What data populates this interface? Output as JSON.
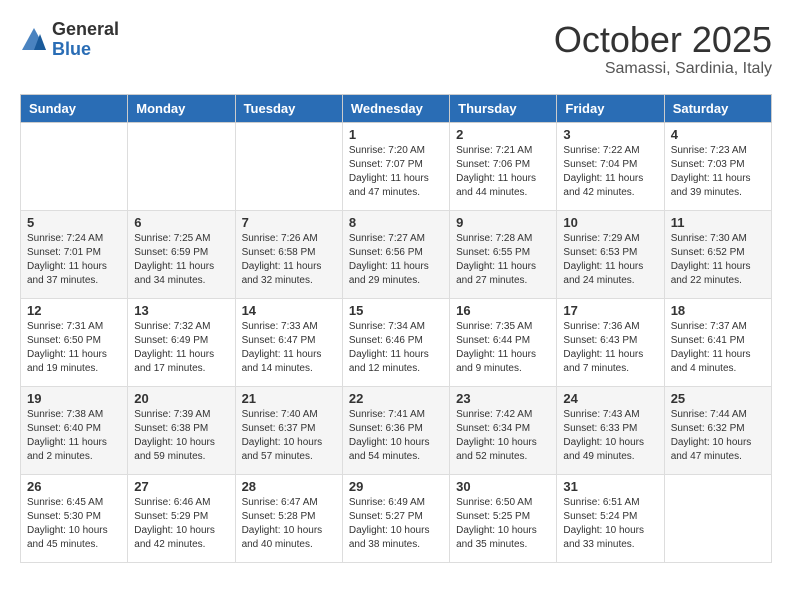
{
  "header": {
    "logo_general": "General",
    "logo_blue": "Blue",
    "month_title": "October 2025",
    "location": "Samassi, Sardinia, Italy"
  },
  "weekdays": [
    "Sunday",
    "Monday",
    "Tuesday",
    "Wednesday",
    "Thursday",
    "Friday",
    "Saturday"
  ],
  "weeks": [
    [
      {
        "day": "",
        "info": ""
      },
      {
        "day": "",
        "info": ""
      },
      {
        "day": "",
        "info": ""
      },
      {
        "day": "1",
        "info": "Sunrise: 7:20 AM\nSunset: 7:07 PM\nDaylight: 11 hours\nand 47 minutes."
      },
      {
        "day": "2",
        "info": "Sunrise: 7:21 AM\nSunset: 7:06 PM\nDaylight: 11 hours\nand 44 minutes."
      },
      {
        "day": "3",
        "info": "Sunrise: 7:22 AM\nSunset: 7:04 PM\nDaylight: 11 hours\nand 42 minutes."
      },
      {
        "day": "4",
        "info": "Sunrise: 7:23 AM\nSunset: 7:03 PM\nDaylight: 11 hours\nand 39 minutes."
      }
    ],
    [
      {
        "day": "5",
        "info": "Sunrise: 7:24 AM\nSunset: 7:01 PM\nDaylight: 11 hours\nand 37 minutes."
      },
      {
        "day": "6",
        "info": "Sunrise: 7:25 AM\nSunset: 6:59 PM\nDaylight: 11 hours\nand 34 minutes."
      },
      {
        "day": "7",
        "info": "Sunrise: 7:26 AM\nSunset: 6:58 PM\nDaylight: 11 hours\nand 32 minutes."
      },
      {
        "day": "8",
        "info": "Sunrise: 7:27 AM\nSunset: 6:56 PM\nDaylight: 11 hours\nand 29 minutes."
      },
      {
        "day": "9",
        "info": "Sunrise: 7:28 AM\nSunset: 6:55 PM\nDaylight: 11 hours\nand 27 minutes."
      },
      {
        "day": "10",
        "info": "Sunrise: 7:29 AM\nSunset: 6:53 PM\nDaylight: 11 hours\nand 24 minutes."
      },
      {
        "day": "11",
        "info": "Sunrise: 7:30 AM\nSunset: 6:52 PM\nDaylight: 11 hours\nand 22 minutes."
      }
    ],
    [
      {
        "day": "12",
        "info": "Sunrise: 7:31 AM\nSunset: 6:50 PM\nDaylight: 11 hours\nand 19 minutes."
      },
      {
        "day": "13",
        "info": "Sunrise: 7:32 AM\nSunset: 6:49 PM\nDaylight: 11 hours\nand 17 minutes."
      },
      {
        "day": "14",
        "info": "Sunrise: 7:33 AM\nSunset: 6:47 PM\nDaylight: 11 hours\nand 14 minutes."
      },
      {
        "day": "15",
        "info": "Sunrise: 7:34 AM\nSunset: 6:46 PM\nDaylight: 11 hours\nand 12 minutes."
      },
      {
        "day": "16",
        "info": "Sunrise: 7:35 AM\nSunset: 6:44 PM\nDaylight: 11 hours\nand 9 minutes."
      },
      {
        "day": "17",
        "info": "Sunrise: 7:36 AM\nSunset: 6:43 PM\nDaylight: 11 hours\nand 7 minutes."
      },
      {
        "day": "18",
        "info": "Sunrise: 7:37 AM\nSunset: 6:41 PM\nDaylight: 11 hours\nand 4 minutes."
      }
    ],
    [
      {
        "day": "19",
        "info": "Sunrise: 7:38 AM\nSunset: 6:40 PM\nDaylight: 11 hours\nand 2 minutes."
      },
      {
        "day": "20",
        "info": "Sunrise: 7:39 AM\nSunset: 6:38 PM\nDaylight: 10 hours\nand 59 minutes."
      },
      {
        "day": "21",
        "info": "Sunrise: 7:40 AM\nSunset: 6:37 PM\nDaylight: 10 hours\nand 57 minutes."
      },
      {
        "day": "22",
        "info": "Sunrise: 7:41 AM\nSunset: 6:36 PM\nDaylight: 10 hours\nand 54 minutes."
      },
      {
        "day": "23",
        "info": "Sunrise: 7:42 AM\nSunset: 6:34 PM\nDaylight: 10 hours\nand 52 minutes."
      },
      {
        "day": "24",
        "info": "Sunrise: 7:43 AM\nSunset: 6:33 PM\nDaylight: 10 hours\nand 49 minutes."
      },
      {
        "day": "25",
        "info": "Sunrise: 7:44 AM\nSunset: 6:32 PM\nDaylight: 10 hours\nand 47 minutes."
      }
    ],
    [
      {
        "day": "26",
        "info": "Sunrise: 6:45 AM\nSunset: 5:30 PM\nDaylight: 10 hours\nand 45 minutes."
      },
      {
        "day": "27",
        "info": "Sunrise: 6:46 AM\nSunset: 5:29 PM\nDaylight: 10 hours\nand 42 minutes."
      },
      {
        "day": "28",
        "info": "Sunrise: 6:47 AM\nSunset: 5:28 PM\nDaylight: 10 hours\nand 40 minutes."
      },
      {
        "day": "29",
        "info": "Sunrise: 6:49 AM\nSunset: 5:27 PM\nDaylight: 10 hours\nand 38 minutes."
      },
      {
        "day": "30",
        "info": "Sunrise: 6:50 AM\nSunset: 5:25 PM\nDaylight: 10 hours\nand 35 minutes."
      },
      {
        "day": "31",
        "info": "Sunrise: 6:51 AM\nSunset: 5:24 PM\nDaylight: 10 hours\nand 33 minutes."
      },
      {
        "day": "",
        "info": ""
      }
    ]
  ]
}
